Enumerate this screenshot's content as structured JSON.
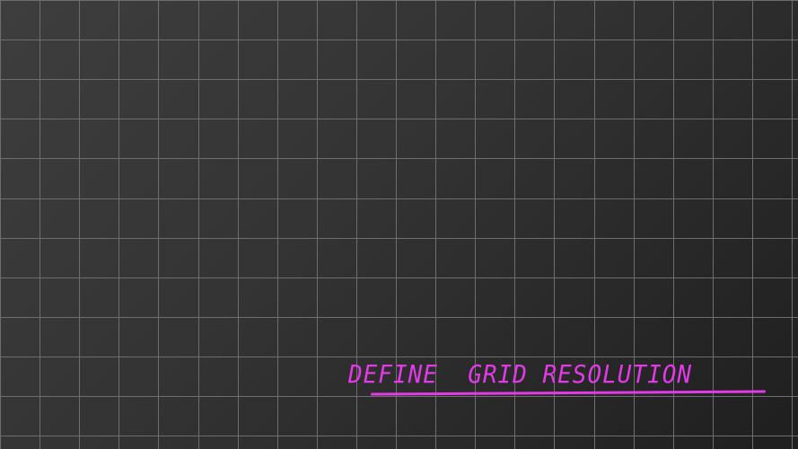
{
  "workspace": {
    "background_start": "#3e3e3e",
    "background_end": "#1f1f1f",
    "grid_color": "#6e6e6e",
    "grid_columns": 20,
    "grid_rows": 11
  },
  "annotation": {
    "text": "DEFINE  GRID RESOLUTION",
    "color": "#e33ae8",
    "underline": true
  }
}
